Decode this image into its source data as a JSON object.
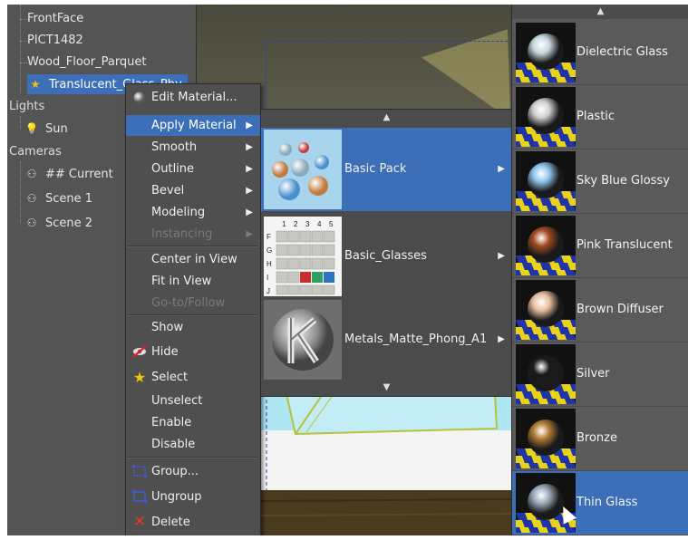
{
  "scene_tree": {
    "materials": [
      "FrontFace",
      "PICT1482",
      "Wood_Floor_Parquet",
      "Translucent_Glass_Phy"
    ],
    "lights_header": "Lights",
    "lights": [
      "Sun"
    ],
    "cameras_header": "Cameras",
    "cameras": [
      "## Current",
      "Scene 1",
      "Scene 2"
    ]
  },
  "context_menu": {
    "items": [
      {
        "label": "Edit Material...",
        "icon": "sphere-icon",
        "submenu": false,
        "state": "normal"
      },
      {
        "label": "Apply Material",
        "submenu": true,
        "state": "active"
      },
      {
        "label": "Smooth",
        "submenu": true,
        "state": "normal"
      },
      {
        "label": "Outline",
        "submenu": true,
        "state": "normal"
      },
      {
        "label": "Bevel",
        "submenu": true,
        "state": "normal"
      },
      {
        "label": "Modeling",
        "submenu": true,
        "state": "normal"
      },
      {
        "label": "Instancing",
        "submenu": true,
        "state": "disabled"
      },
      {
        "label": "Center in View",
        "submenu": false,
        "state": "normal"
      },
      {
        "label": "Fit in View",
        "submenu": false,
        "state": "normal"
      },
      {
        "label": "Go-to/Follow",
        "submenu": false,
        "state": "disabled"
      },
      {
        "label": "Show",
        "submenu": false,
        "state": "normal"
      },
      {
        "label": "Hide",
        "icon": "hide-icon",
        "submenu": false,
        "state": "normal"
      },
      {
        "label": "Select",
        "icon": "star-icon",
        "submenu": false,
        "state": "normal"
      },
      {
        "label": "Unselect",
        "submenu": false,
        "state": "normal"
      },
      {
        "label": "Enable",
        "submenu": false,
        "state": "normal"
      },
      {
        "label": "Disable",
        "submenu": false,
        "state": "normal"
      },
      {
        "label": "Group...",
        "icon": "group-icon",
        "submenu": false,
        "state": "normal"
      },
      {
        "label": "Ungroup",
        "icon": "ungroup-icon",
        "submenu": false,
        "state": "normal"
      },
      {
        "label": "Delete",
        "icon": "delete-icon",
        "submenu": false,
        "state": "normal"
      }
    ]
  },
  "material_packs": {
    "items": [
      {
        "label": "Basic Pack",
        "state": "active"
      },
      {
        "label": "Basic_Glasses",
        "state": "normal"
      },
      {
        "label": "Metals_Matte_Phong_A1",
        "state": "normal"
      }
    ],
    "glasses_thumb_cols": [
      "1",
      "2",
      "3",
      "4",
      "5"
    ],
    "glasses_thumb_rows": [
      "F",
      "G",
      "H",
      "I",
      "J"
    ]
  },
  "materials": {
    "items": [
      {
        "label": "Dielectric Glass",
        "ball": "#c9d8e0",
        "state": "normal"
      },
      {
        "label": "Plastic",
        "ball": "#d0d0d0",
        "state": "normal"
      },
      {
        "label": "Sky Blue Glossy",
        "ball": "#8ec4ea",
        "state": "normal"
      },
      {
        "label": "Pink Translucent",
        "ball": "#a24a22",
        "state": "normal"
      },
      {
        "label": "Brown Diffuser",
        "ball": "#e8c0a2",
        "state": "normal"
      },
      {
        "label": "Silver",
        "ball": "#1a1a1a",
        "state": "normal"
      },
      {
        "label": "Bronze",
        "ball": "#b07a30",
        "state": "normal"
      },
      {
        "label": "Thin Glass",
        "ball": "#9aaab8",
        "state": "active"
      }
    ]
  },
  "colors": {
    "highlight": "#3d6fb8",
    "menu_bg": "#4f4f4f",
    "panel_bg": "#545454",
    "checker_blue": "#1f34a8",
    "checker_yellow": "#e8d21a"
  }
}
